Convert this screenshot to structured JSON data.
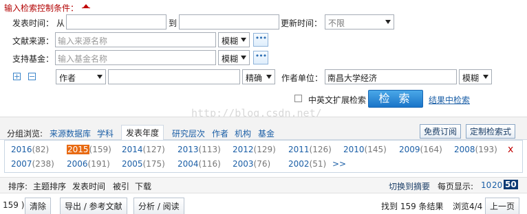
{
  "header": {
    "title": "输入检索控制条件："
  },
  "row_date": {
    "label": "发表时间：",
    "from_label": "从",
    "to_label": "到",
    "update_label": "更新时间：",
    "update_value": "不限"
  },
  "row_source": {
    "label": "文献来源：",
    "placeholder": "输入来源名称",
    "match": "模糊"
  },
  "row_fund": {
    "label": "支持基金：",
    "placeholder": "输入基金名称",
    "match": "模糊"
  },
  "row_author": {
    "field": "作者",
    "match": "精确",
    "unit_label": "作者单位：",
    "unit_value": "南昌大学经济",
    "unit_match": "模糊"
  },
  "extend": {
    "checkbox_label": "中英文扩展检索",
    "search_button": "检 索",
    "result_search_link": "结果中检索"
  },
  "watermark": "http://blog.csdn.net/",
  "group": {
    "label": "分组浏览:",
    "tabs": [
      "来源数据库",
      "学科",
      "发表年度",
      "研究层次",
      "作者",
      "机构",
      "基金"
    ],
    "right_buttons": [
      "免费订阅",
      "定制检索式"
    ]
  },
  "years_row1": [
    {
      "year": "2016",
      "count": "(82)"
    },
    {
      "year": "2015",
      "count": "(159)"
    },
    {
      "year": "2014",
      "count": "(127)"
    },
    {
      "year": "2013",
      "count": "(113)"
    },
    {
      "year": "2012",
      "count": "(129)"
    },
    {
      "year": "2011",
      "count": "(126)"
    },
    {
      "year": "2010",
      "count": "(145)"
    },
    {
      "year": "2009",
      "count": "(164)"
    },
    {
      "year": "2008",
      "count": "(193)"
    }
  ],
  "years_row2": [
    {
      "year": "2007",
      "count": "(238)"
    },
    {
      "year": "2006",
      "count": "(191)"
    },
    {
      "year": "2005",
      "count": "(175)"
    },
    {
      "year": "2004",
      "count": "(116)"
    },
    {
      "year": "2003",
      "count": "(76)"
    },
    {
      "year": "2002",
      "count": "(51)"
    }
  ],
  "years_more": ">>",
  "years_close": "x",
  "sort": {
    "label": "排序:",
    "items": [
      "主题排序",
      "发表时间",
      "被引",
      "下载"
    ],
    "switch": "切换到摘要",
    "per_page_label": "每页显示:",
    "per_page": [
      "10",
      "20",
      "50"
    ]
  },
  "bottom": {
    "selected_count": "159 )",
    "buttons": [
      "清除",
      "导出 / 参考文献",
      "分析 / 阅读"
    ],
    "found": "找到 159 条结果",
    "page_info": "浏览4/4",
    "prev": "上一页"
  }
}
